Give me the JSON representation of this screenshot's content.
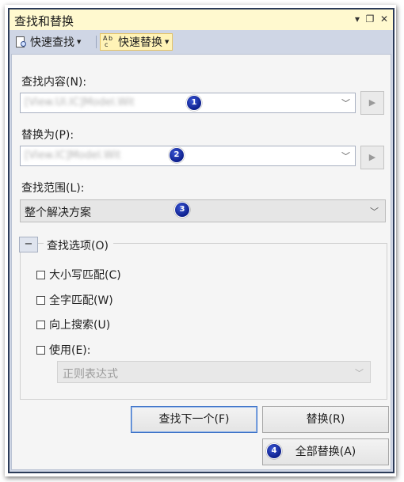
{
  "window": {
    "title": "查找和替换",
    "controls": {
      "menu": "▾",
      "maximize": "❐",
      "close": "✕"
    }
  },
  "toolbar": {
    "quick_find": "快速查找",
    "quick_replace": "快速替换"
  },
  "find": {
    "label": "查找内容(N):",
    "value": "[View.UI.IC]Model.Wit",
    "badge": "1"
  },
  "replace": {
    "label": "替换为(P):",
    "value": "[View.IC]Model.Wit",
    "badge": "2"
  },
  "scope": {
    "label": "查找范围(L):",
    "value": "整个解决方案",
    "badge": "3"
  },
  "options": {
    "group_toggle": "−",
    "title": "查找选项(O)",
    "match_case": "大小写匹配(C)",
    "whole_word": "全字匹配(W)",
    "search_up": "向上搜索(U)",
    "use": "使用(E):",
    "use_value": "正则表达式"
  },
  "buttons": {
    "find_next": "查找下一个(F)",
    "replace": "替换(R)",
    "replace_all": "全部替换(A)",
    "replace_all_badge": "4"
  },
  "colors": {
    "title_bar": "#fff9cf",
    "window_border": "#2b3b58",
    "badge": "#0d1f8c",
    "primary_button_border": "#3e73c8"
  }
}
